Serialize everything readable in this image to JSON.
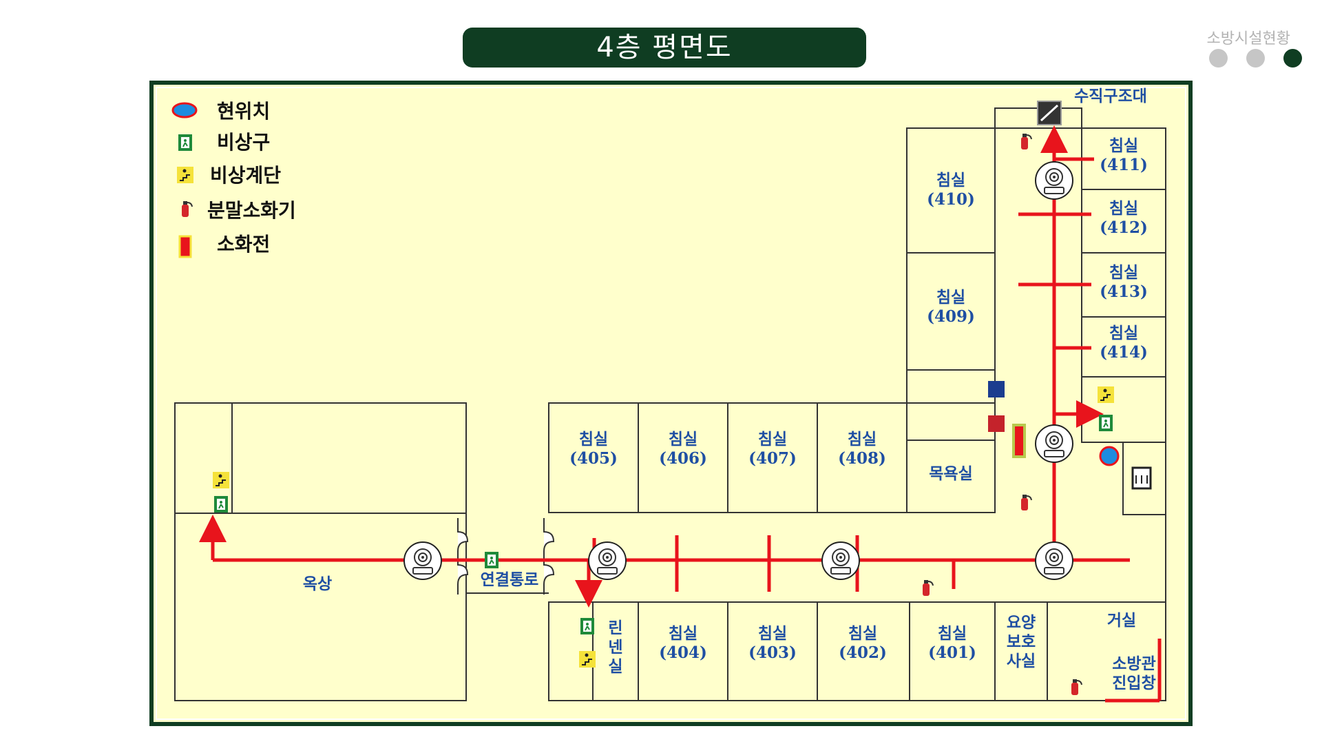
{
  "page_title": "4층 평면도",
  "top_right_label": "소방시설현황",
  "page_indicator": {
    "count": 3,
    "active_index": 2
  },
  "colors": {
    "accent": "#0f3d22",
    "floor": "#ffffcc",
    "route": "#e8141c",
    "label_blue": "#1f4fa3",
    "dot_inactive": "#c6c6c6"
  },
  "legend": [
    {
      "icon": "current-location-icon",
      "label": "현위치"
    },
    {
      "icon": "emergency-exit-icon",
      "label": "비상구"
    },
    {
      "icon": "emergency-stairs-icon",
      "label": "비상계단"
    },
    {
      "icon": "fire-extinguisher-icon",
      "label": "분말소화기"
    },
    {
      "icon": "fire-hydrant-icon",
      "label": "소화전"
    }
  ],
  "rooms": {
    "r410": {
      "name": "침실",
      "num": "(410)"
    },
    "r409": {
      "name": "침실",
      "num": "(409)"
    },
    "r411": {
      "name": "침실",
      "num": "(411)"
    },
    "r412": {
      "name": "침실",
      "num": "(412)"
    },
    "r413": {
      "name": "침실",
      "num": "(413)"
    },
    "r414": {
      "name": "침실",
      "num": "(414)"
    },
    "r405": {
      "name": "침실",
      "num": "(405)"
    },
    "r406": {
      "name": "침실",
      "num": "(406)"
    },
    "r407": {
      "name": "침실",
      "num": "(407)"
    },
    "r408": {
      "name": "침실",
      "num": "(408)"
    },
    "r404": {
      "name": "침실",
      "num": "(404)"
    },
    "r403": {
      "name": "침실",
      "num": "(403)"
    },
    "r402": {
      "name": "침실",
      "num": "(402)"
    },
    "r401": {
      "name": "침실",
      "num": "(401)"
    },
    "bath": {
      "name": "목욕실"
    },
    "rooftop": {
      "name": "옥상"
    },
    "passage": {
      "name": "연결통로"
    },
    "linen": {
      "lines": [
        "린",
        "넨",
        "실"
      ]
    },
    "office": {
      "lines": [
        "요양",
        "보호",
        "사실"
      ]
    },
    "living": {
      "name": "거실"
    },
    "fire_window": {
      "lines": [
        "소방관",
        "진입창"
      ]
    },
    "rescue": {
      "name": "수직구조대"
    }
  }
}
